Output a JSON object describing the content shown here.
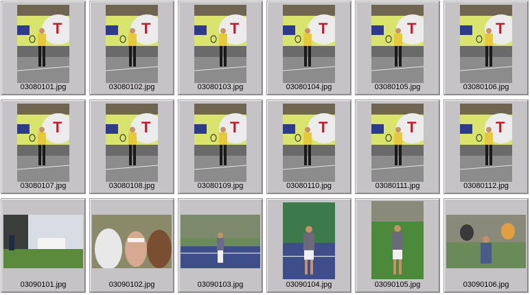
{
  "thumbnails": [
    {
      "filename": "03080101.jpg",
      "kind": "court"
    },
    {
      "filename": "03080102.jpg",
      "kind": "court"
    },
    {
      "filename": "03080103.jpg",
      "kind": "court"
    },
    {
      "filename": "03080104.jpg",
      "kind": "court"
    },
    {
      "filename": "03080105.jpg",
      "kind": "court"
    },
    {
      "filename": "03080106.jpg",
      "kind": "court"
    },
    {
      "filename": "03080107.jpg",
      "kind": "court"
    },
    {
      "filename": "03080108.jpg",
      "kind": "court"
    },
    {
      "filename": "03080109.jpg",
      "kind": "court"
    },
    {
      "filename": "03080110.jpg",
      "kind": "court"
    },
    {
      "filename": "03080111.jpg",
      "kind": "court"
    },
    {
      "filename": "03080112.jpg",
      "kind": "court"
    },
    {
      "filename": "03090101.jpg",
      "kind": "crowd"
    },
    {
      "filename": "03090102.jpg",
      "kind": "crowd-close"
    },
    {
      "filename": "03090103.jpg",
      "kind": "blue-court"
    },
    {
      "filename": "03090104.jpg",
      "kind": "green-court"
    },
    {
      "filename": "03090105.jpg",
      "kind": "green-player"
    },
    {
      "filename": "03090106.jpg",
      "kind": "crowd-player"
    }
  ]
}
